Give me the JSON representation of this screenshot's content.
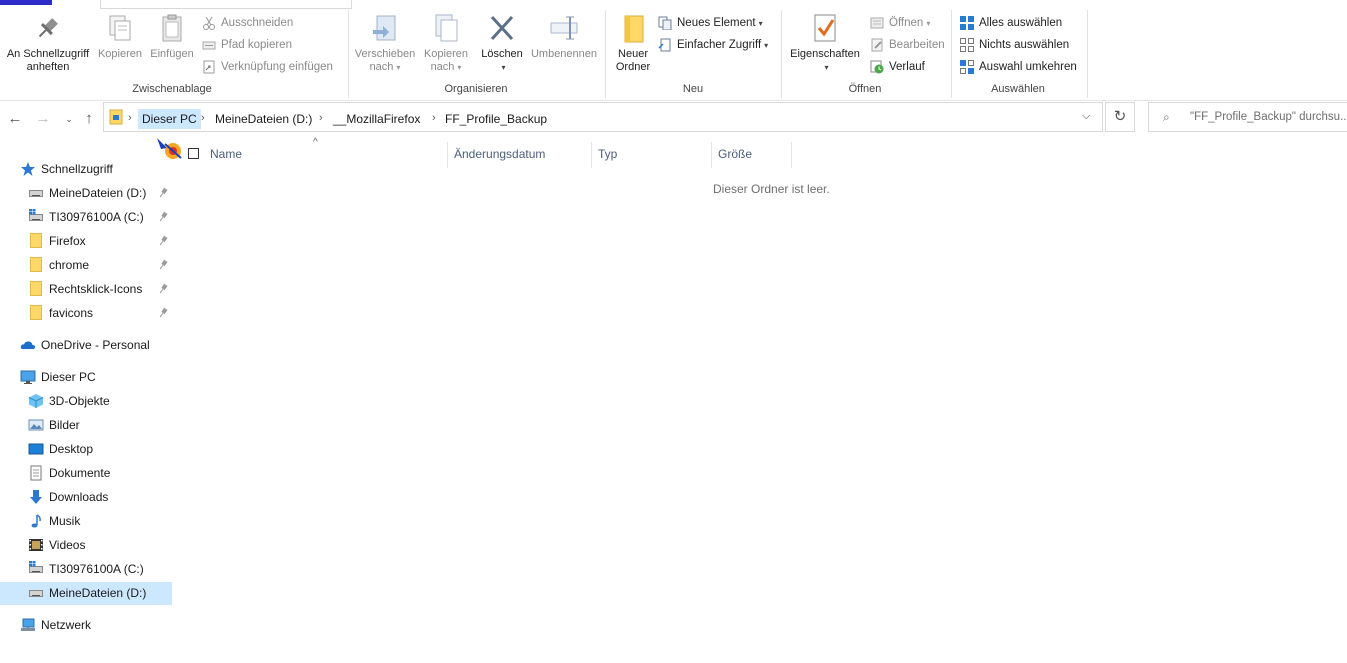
{
  "ribbon": {
    "clipboard": {
      "pin_label_1": "An Schnellzugriff",
      "pin_label_2": "anheften",
      "copy_label": "Kopieren",
      "paste_label": "Einfügen",
      "cut_label": "Ausschneiden",
      "copy_path_label": "Pfad kopieren",
      "paste_shortcut_label": "Verknüpfung einfügen",
      "group_label": "Zwischenablage"
    },
    "organize": {
      "move_label_1": "Verschieben",
      "move_label_2": "nach",
      "copyto_label_1": "Kopieren",
      "copyto_label_2": "nach",
      "delete_label": "Löschen",
      "rename_label": "Umbenennen",
      "group_label": "Organisieren"
    },
    "new": {
      "new_folder_label_1": "Neuer",
      "new_folder_label_2": "Ordner",
      "new_item_label": "Neues Element",
      "easy_access_label": "Einfacher Zugriff",
      "group_label": "Neu"
    },
    "open": {
      "properties_label": "Eigenschaften",
      "open_label": "Öffnen",
      "edit_label": "Bearbeiten",
      "history_label": "Verlauf",
      "group_label": "Öffnen"
    },
    "select": {
      "select_all_label": "Alles auswählen",
      "select_none_label": "Nichts auswählen",
      "invert_label": "Auswahl umkehren",
      "group_label": "Auswählen"
    }
  },
  "address": {
    "crumbs": [
      "Dieser PC",
      "MeineDateien (D:)",
      "__MozillaFirefox",
      "FF_Profile_Backup"
    ],
    "search_placeholder": "\"FF_Profile_Backup\" durchsu..."
  },
  "columns": {
    "name": "Name",
    "date": "Änderungsdatum",
    "type": "Typ",
    "size": "Größe"
  },
  "content": {
    "empty_message": "Dieser Ordner ist leer."
  },
  "nav": {
    "quick_access": "Schnellzugriff",
    "quick_items": [
      "MeineDateien (D:)",
      "TI30976100A (C:)",
      "Firefox",
      "chrome",
      "Rechtsklick-Icons",
      "favicons"
    ],
    "onedrive": "OneDrive - Personal",
    "this_pc": "Dieser PC",
    "pc_items": [
      "3D-Objekte",
      "Bilder",
      "Desktop",
      "Dokumente",
      "Downloads",
      "Musik",
      "Videos",
      "TI30976100A (C:)",
      "MeineDateien (D:)"
    ],
    "network": "Netzwerk"
  },
  "colors": {
    "selection": "#cce8ff",
    "folder_yellow": "#ffd866",
    "accent_blue": "#2b79d0"
  }
}
